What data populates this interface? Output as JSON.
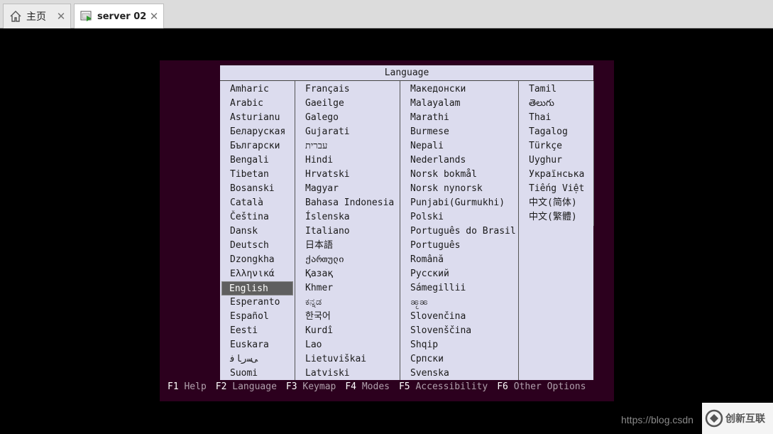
{
  "tabs": [
    {
      "label": "主页",
      "icon": "home-icon"
    },
    {
      "label": "server 02",
      "icon": "vm-console-icon"
    }
  ],
  "dialog": {
    "title": "Language",
    "columns": [
      [
        "Amharic",
        "Arabic",
        "Asturianu",
        "Беларуская",
        "Български",
        "Bengali",
        "Tibetan",
        "Bosanski",
        "Català",
        "Čeština",
        "Dansk",
        "Deutsch",
        "Dzongkha",
        "Ελληνικά",
        "English",
        "Esperanto",
        "Español",
        "Eesti",
        "Euskara",
        "ﻰﺳﺭﺎﻓ",
        "Suomi"
      ],
      [
        "Français",
        "Gaeilge",
        "Galego",
        "Gujarati",
        "עברית",
        "Hindi",
        "Hrvatski",
        "Magyar",
        "Bahasa Indonesia",
        "Íslenska",
        "Italiano",
        "日本語",
        "ქართული",
        "Қазақ",
        "Khmer",
        "ಕನ್ನಡ",
        "한국어",
        "Kurdî",
        "Lao",
        "Lietuviškai",
        "Latviski"
      ],
      [
        "Македонски",
        "Malayalam",
        "Marathi",
        "Burmese",
        "Nepali",
        "Nederlands",
        "Norsk bokmål",
        "Norsk nynorsk",
        "Punjabi(Gurmukhi)",
        "Polski",
        "Português do Brasil",
        "Português",
        "Română",
        "Русский",
        "Sámegillii",
        "ၼႂၼ",
        "Slovenčina",
        "Slovenščina",
        "Shqip",
        "Српски",
        "Svenska"
      ],
      [
        "Tamil",
        "తెలుగు",
        "Thai",
        "Tagalog",
        "Türkçe",
        "Uyghur",
        "Українська",
        "Tiếng Việt",
        "中文(简体)",
        "中文(繁體)"
      ]
    ],
    "selected": "English"
  },
  "fkeys": [
    {
      "key": "F1",
      "label": "Help"
    },
    {
      "key": "F2",
      "label": "Language"
    },
    {
      "key": "F3",
      "label": "Keymap"
    },
    {
      "key": "F4",
      "label": "Modes"
    },
    {
      "key": "F5",
      "label": "Accessibility"
    },
    {
      "key": "F6",
      "label": "Other Options"
    }
  ],
  "watermark": {
    "url": "https://blog.csdn",
    "logo_text": "创新互联"
  },
  "colors": {
    "screen_bg": "#2c001e",
    "dialog_bg": "#dcdcee",
    "selection_bg": "#5f5f5f"
  }
}
